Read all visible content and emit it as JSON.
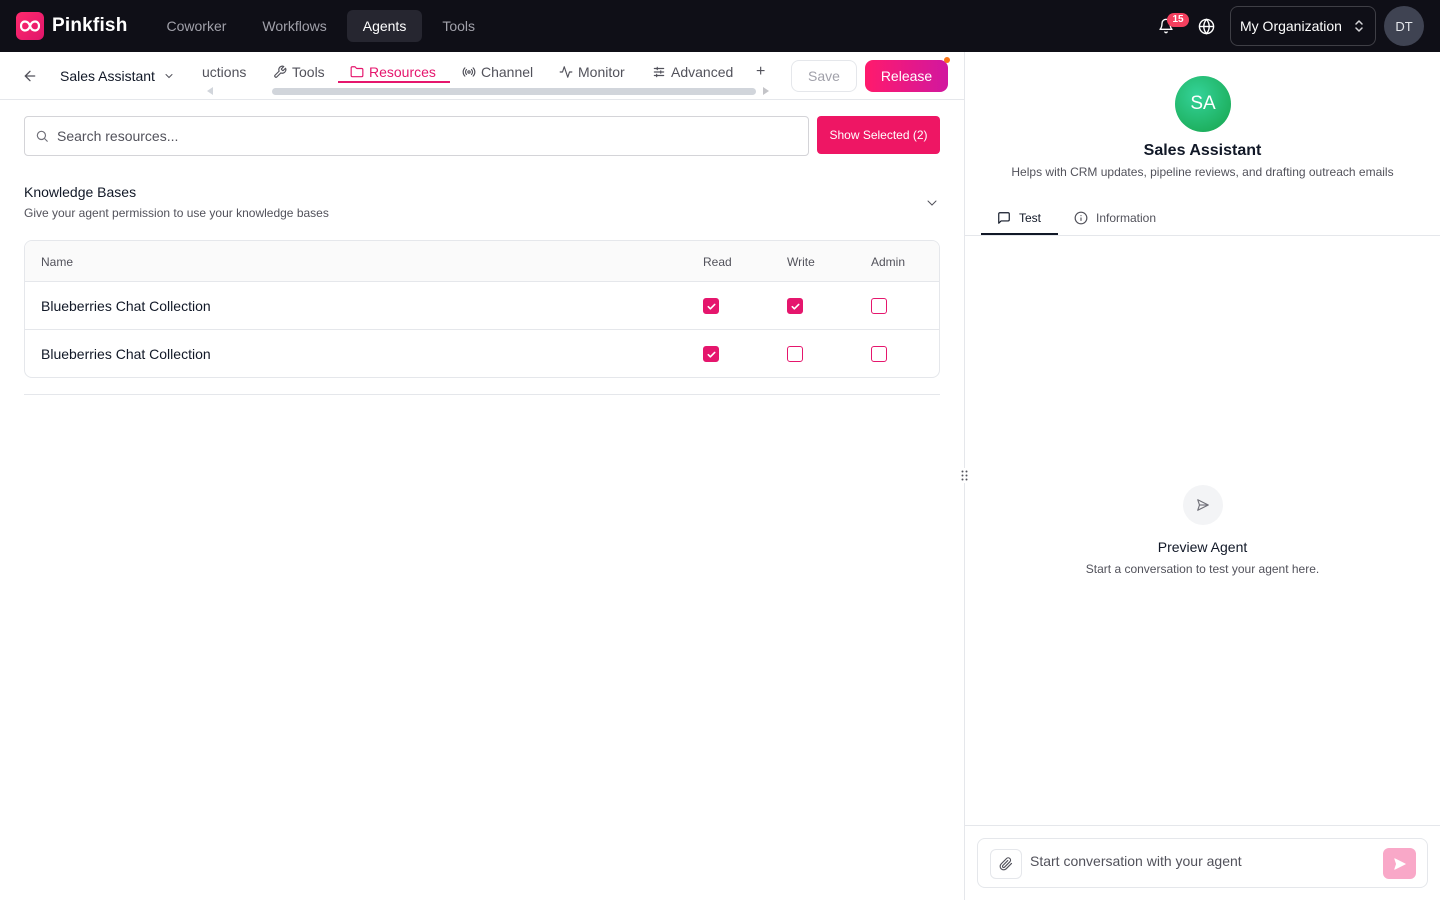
{
  "app": {
    "name": "Pinkfish",
    "brand_color": "#e5166d"
  },
  "topnav": {
    "items": [
      {
        "label": "Coworker"
      },
      {
        "label": "Workflows"
      },
      {
        "label": "Agents",
        "active": true
      },
      {
        "label": "Tools"
      }
    ]
  },
  "topbar": {
    "notification_count": "15",
    "org_name": "My Organization",
    "user_initials": "DT"
  },
  "subbar": {
    "agent_name": "Sales Assistant",
    "tabs": [
      {
        "label": "uctions",
        "icon": ""
      },
      {
        "label": "Tools",
        "icon": "wrench-icon"
      },
      {
        "label": "Resources",
        "icon": "folder-icon",
        "active": true
      },
      {
        "label": "Channel",
        "icon": "broadcast-icon"
      },
      {
        "label": "Monitor",
        "icon": "activity-icon"
      },
      {
        "label": "Advanced",
        "icon": "sliders-icon"
      },
      {
        "label": "+",
        "icon": "plus-icon"
      }
    ],
    "save_label": "Save",
    "release_label": "Release"
  },
  "search": {
    "placeholder": "Search resources...",
    "value": "",
    "show_selected_label": "Show Selected (2)"
  },
  "knowledge_bases": {
    "title": "Knowledge Bases",
    "description": "Give your agent permission to use your knowledge bases",
    "columns": [
      "Name",
      "Read",
      "Write",
      "Admin"
    ],
    "rows": [
      {
        "name": "Blueberries Chat Collection",
        "read": true,
        "write": true,
        "admin": false
      },
      {
        "name": "Blueberries Chat Collection",
        "read": true,
        "write": false,
        "admin": false
      }
    ]
  },
  "preview": {
    "avatar_initials": "SA",
    "agent_name": "Sales Assistant",
    "agent_description": "Helps with CRM updates, pipeline reviews, and drafting outreach emails",
    "tabs": [
      {
        "label": "Test",
        "icon": "message-icon",
        "active": true
      },
      {
        "label": "Information",
        "icon": "info-icon"
      }
    ],
    "empty_title": "Preview Agent",
    "empty_subtitle": "Start a conversation to test your agent here.",
    "chat_placeholder": "Start conversation with your agent"
  }
}
